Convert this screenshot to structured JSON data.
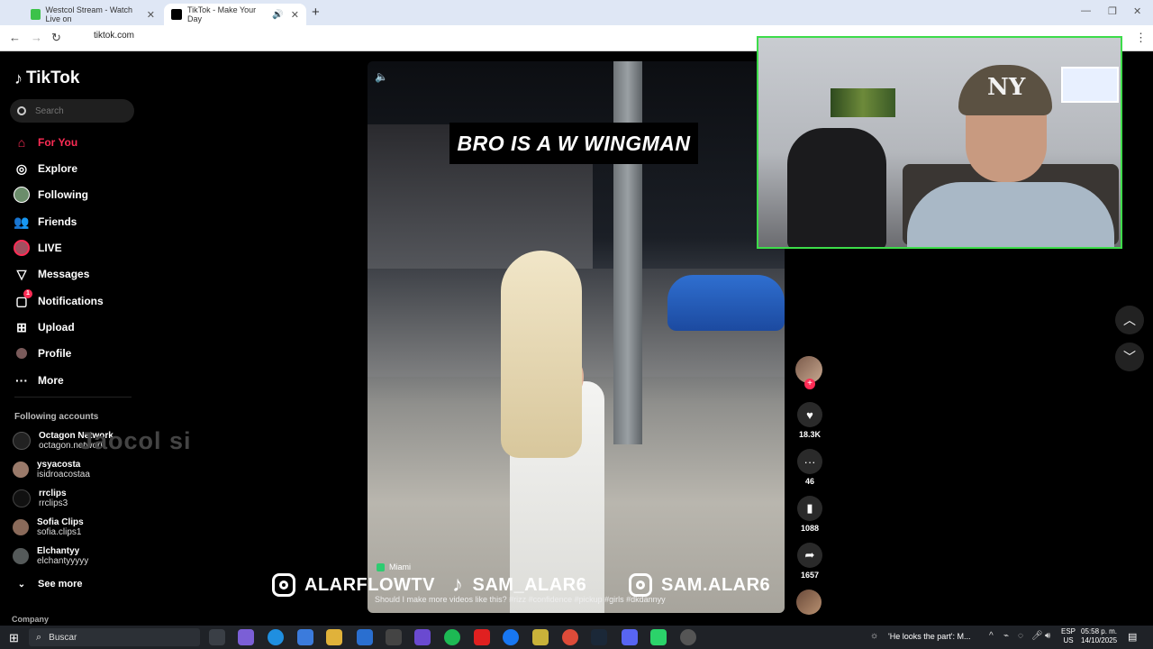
{
  "browser": {
    "tabs": [
      {
        "title": "Westcol Stream - Watch Live on",
        "active": false
      },
      {
        "title": "TikTok - Make Your Day",
        "active": true
      }
    ],
    "url": "tiktok.com"
  },
  "tiktok": {
    "logo": "TikTok",
    "search_placeholder": "Search",
    "nav": [
      {
        "label": "For You",
        "icon": "home-icon"
      },
      {
        "label": "Explore",
        "icon": "compass-icon"
      },
      {
        "label": "Following",
        "icon": "following-avatar-icon"
      },
      {
        "label": "Friends",
        "icon": "friends-icon"
      },
      {
        "label": "LIVE",
        "icon": "live-icon"
      },
      {
        "label": "Messages",
        "icon": "paper-plane-icon"
      },
      {
        "label": "Notifications",
        "icon": "inbox-icon",
        "badge": "1"
      },
      {
        "label": "Upload",
        "icon": "plus-square-icon"
      },
      {
        "label": "Profile",
        "icon": "profile-icon"
      },
      {
        "label": "More",
        "icon": "more-dots-icon"
      }
    ],
    "following_section_title": "Following accounts",
    "following_accounts": [
      {
        "name": "Octagon Network",
        "handle": "octagon.network"
      },
      {
        "name": "ysyacosta",
        "handle": "isidroacostaa"
      },
      {
        "name": "rrclips",
        "handle": "rrclips3"
      },
      {
        "name": "Sofia Clips",
        "handle": "sofia.clips1"
      },
      {
        "name": "Elchantyy",
        "handle": "elchantyyyyy"
      }
    ],
    "see_more": "See more",
    "company": "Company",
    "watermark": "Jaocol si"
  },
  "video": {
    "caption_overlay": "BRO IS A W WINGMAN",
    "location": "Miami",
    "description": "Should I make more videos like this? #rizz #confidence #pickup #girls #dkdannyy",
    "likes": "18.3K",
    "comments": "46",
    "saves": "1088",
    "shares": "1657"
  },
  "socials": [
    {
      "platform": "instagram",
      "handle": "ALARFLOWTV"
    },
    {
      "platform": "tiktok",
      "handle": "SAM_ALAR6"
    },
    {
      "platform": "instagram",
      "handle": "SAM.ALAR6"
    }
  ],
  "webcam": {
    "cap_logo": "NY"
  },
  "taskbar": {
    "search_placeholder": "Buscar",
    "news": "'He looks the part': M...",
    "lang_line1": "ESP",
    "lang_line2": "US",
    "time": "05:58 p. m.",
    "date": "14/10/2025"
  },
  "colors": {
    "tiktok_red": "#fe2c55",
    "webcam_border": "#3ddc4a"
  }
}
